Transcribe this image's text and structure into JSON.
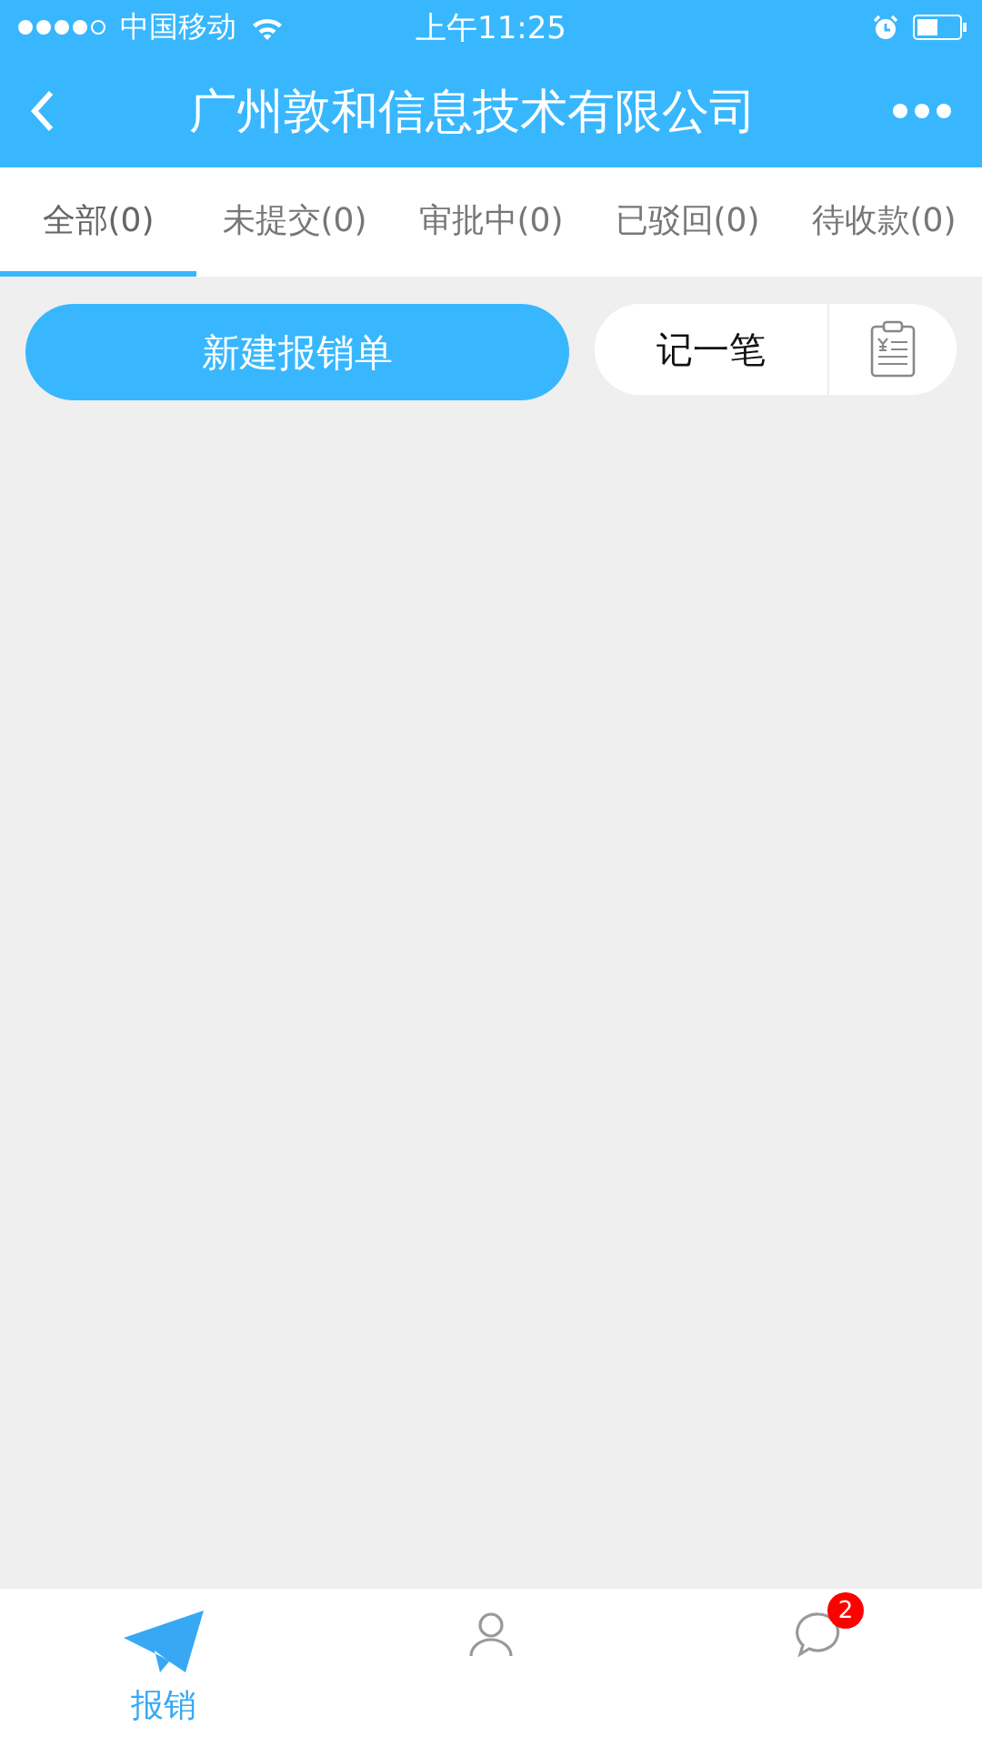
{
  "status_bar": {
    "carrier": "中国移动",
    "time": "上午11:25"
  },
  "nav": {
    "title": "广州敦和信息技术有限公司"
  },
  "tabs": [
    {
      "label": "全部(0)",
      "selected": true
    },
    {
      "label": "未提交(0)",
      "selected": false
    },
    {
      "label": "审批中(0)",
      "selected": false
    },
    {
      "label": "已驳回(0)",
      "selected": false
    },
    {
      "label": "待收款(0)",
      "selected": false
    }
  ],
  "actions": {
    "primary": "新建报销单",
    "secondary": "记一笔"
  },
  "tab_bar": [
    {
      "kind": "plane",
      "label": "报销",
      "selected": true
    },
    {
      "kind": "person",
      "selected": false
    },
    {
      "kind": "chat",
      "badge": "2",
      "selected": false
    }
  ]
}
